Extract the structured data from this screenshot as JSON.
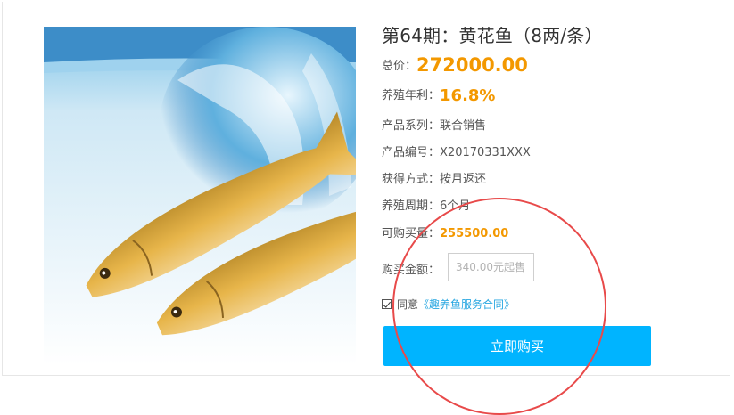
{
  "product": {
    "title": "第64期：黄花鱼（8两/条）",
    "total_price_label": "总价：",
    "total_price": "272000.00",
    "annual_rate_label": "养殖年利：",
    "annual_rate": "16.8%",
    "series_label": "产品系列：",
    "series": "联合销售",
    "code_label": "产品编号：",
    "code": "X20170331XXX",
    "method_label": "获得方式：",
    "method": "按月返还",
    "period_label": "养殖周期：",
    "period": "6个月",
    "available_label": "可购买量：",
    "available": "255500.00"
  },
  "purchase": {
    "amount_label": "购买金额：",
    "amount_placeholder": "340.00元起售",
    "agree_label": "同意",
    "contract_link": "《趣养鱼服务合同》",
    "buy_button": "立即购买"
  },
  "colors": {
    "accent_orange": "#f39800",
    "button_blue": "#00b4ff",
    "link_blue": "#28a7e1",
    "annotation_red": "#e84a4a"
  }
}
